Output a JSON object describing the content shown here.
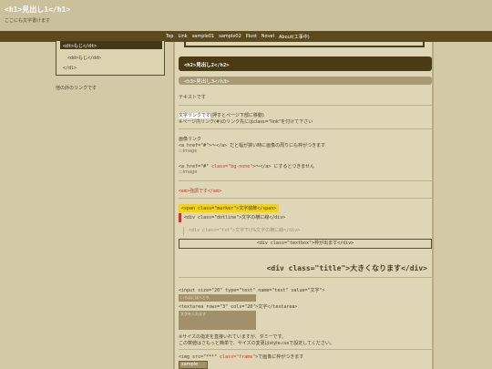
{
  "header": {
    "title": "<h1>見出し1</h1>",
    "description": "ここにも文字書けます"
  },
  "nav": {
    "items": [
      "Top",
      "Link",
      "sample01",
      "sample02",
      "Illust",
      "Novel",
      "About(工事中)"
    ]
  },
  "sidebar": {
    "dt": "<dt>もじ</dt>",
    "dd": "<dd>もじ</dd>",
    "dl_end": "</dl>",
    "link_text": "他の外のリンクです"
  },
  "main": {
    "h2": "<h2>見出し2</h2>",
    "h3": "<h3>見出し3</h3>",
    "text": "テキストです",
    "link_label": "文字リンクです",
    "link_note": "(押すとページ下部に移動)",
    "link_note2": "※ページ内リンク(#)のリンク先にはclass=\"link\"を付けて下さい",
    "img_link_heading": "画像リンク",
    "img_link_code": "<a href=\"#\">〜</a> だと幅が狭い時に画像の周りにも枠がつきます",
    "img_alt": "image",
    "img_link_code2_a": "<a href=\"#\" ",
    "img_link_code2_b": "class=\"bg-none\"",
    "img_link_code2_c": ">〜</a> にするとつきません",
    "img_alt2": "image",
    "em": "<em>強調です</em>",
    "marker": "<span class=\"marker\">文字装飾</span>",
    "dotline": "<div class=\"dotline\">文字の横に線</div>",
    "txtline": "<div class=\"txt\">文字下げ&文字の横に線</div>",
    "textbox": "<div class=\"textbox\">枠が出ます</div>",
    "title_big": "<div class=\"title\">大きくなります</div>",
    "input_code": "<input size=\"20\" type=\"text\" name=\"text\" value=\"文字\">",
    "input_value": "いろはにほへとち",
    "textarea_code": "<textarea rows=\"3\" cols=\"20\">文字</textarea>",
    "textarea_value": "文字を入れます",
    "size_note1": "※サイズの指定を直接いれていますが、ダミーです。",
    "size_note2": "この数値はさもっと簡単で、サイズの変更はstyle.cssで設定してください。",
    "img_code_a": "<img src=\"***\" ",
    "img_code_b": "class=\"frame\"",
    "img_code_c": ">で画像に枠がつきます",
    "frame_img_alt": "sample"
  },
  "colors": {
    "page_bg": "#d4c9a6",
    "navbar": "#5b4a1e",
    "h2_bg": "#4a3b14",
    "h3_bg": "#a79a74",
    "accent_red": "#c8352c",
    "marker": "#f3d21f"
  }
}
